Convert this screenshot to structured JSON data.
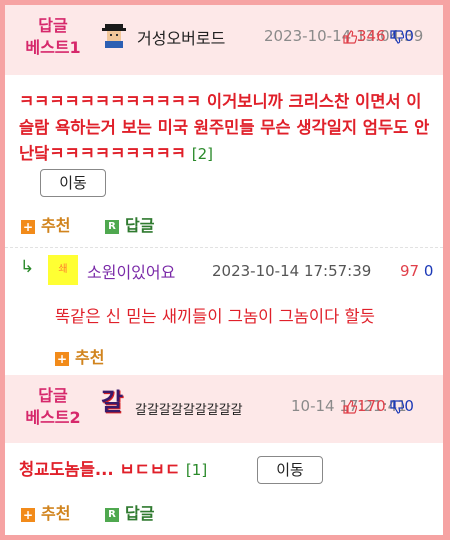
{
  "best1": {
    "badge_line1": "답글",
    "badge_line2": "베스트1",
    "nickname": "거성오버로드",
    "date": "2023-10-14 13:04:39",
    "up_count": "346",
    "down_count": "0",
    "title": "ㅋㅋㅋㅋㅋㅋㅋㅋㅋㅋㅋㅋ 이거보니까 크리스찬 이면서 이슬람 욕하는거 보는 미국 원주민들 무슨 생각일지 엄두도 안난닼ㅋㅋㅋㅋㅋㅋㅋㅋㅋ",
    "comment_count": "[2]",
    "move_label": "이동",
    "recommend_label": "추천",
    "reply_label": "답글"
  },
  "reply1": {
    "arrow": "↳",
    "avatar_text": "쇄",
    "nickname": "소원이있어요",
    "date": "2023-10-14 17:57:39",
    "up_count": "97",
    "down_count": "0",
    "body": "똑같은 신 믿는 새끼들이 그놈이 그놈이다 할듯",
    "recommend_label": "추천"
  },
  "best2": {
    "badge_line1": "답글",
    "badge_line2": "베스트2",
    "avatar_text": "갈",
    "nickname": "갈갈갈갈갈갈갈갈갈",
    "date": "10-14 17:21:41",
    "up_count": "170",
    "down_count": "0",
    "title": "청교도놈들... ㅂㄷㅂㄷ",
    "comment_count": "[1]",
    "move_label": "이동",
    "recommend_label": "추천",
    "reply_label": "답글"
  },
  "colors": {
    "accent_red": "#e0202a",
    "best_pink": "#d6286b",
    "frame": "#f6a3a3",
    "up_red": "#e0404a",
    "down_blue": "#1c39b7"
  },
  "icons": [
    "user-avatar-icon",
    "thumb-up-icon",
    "thumb-down-icon",
    "plus-icon",
    "reply-r-icon",
    "reply-arrow-icon"
  ]
}
